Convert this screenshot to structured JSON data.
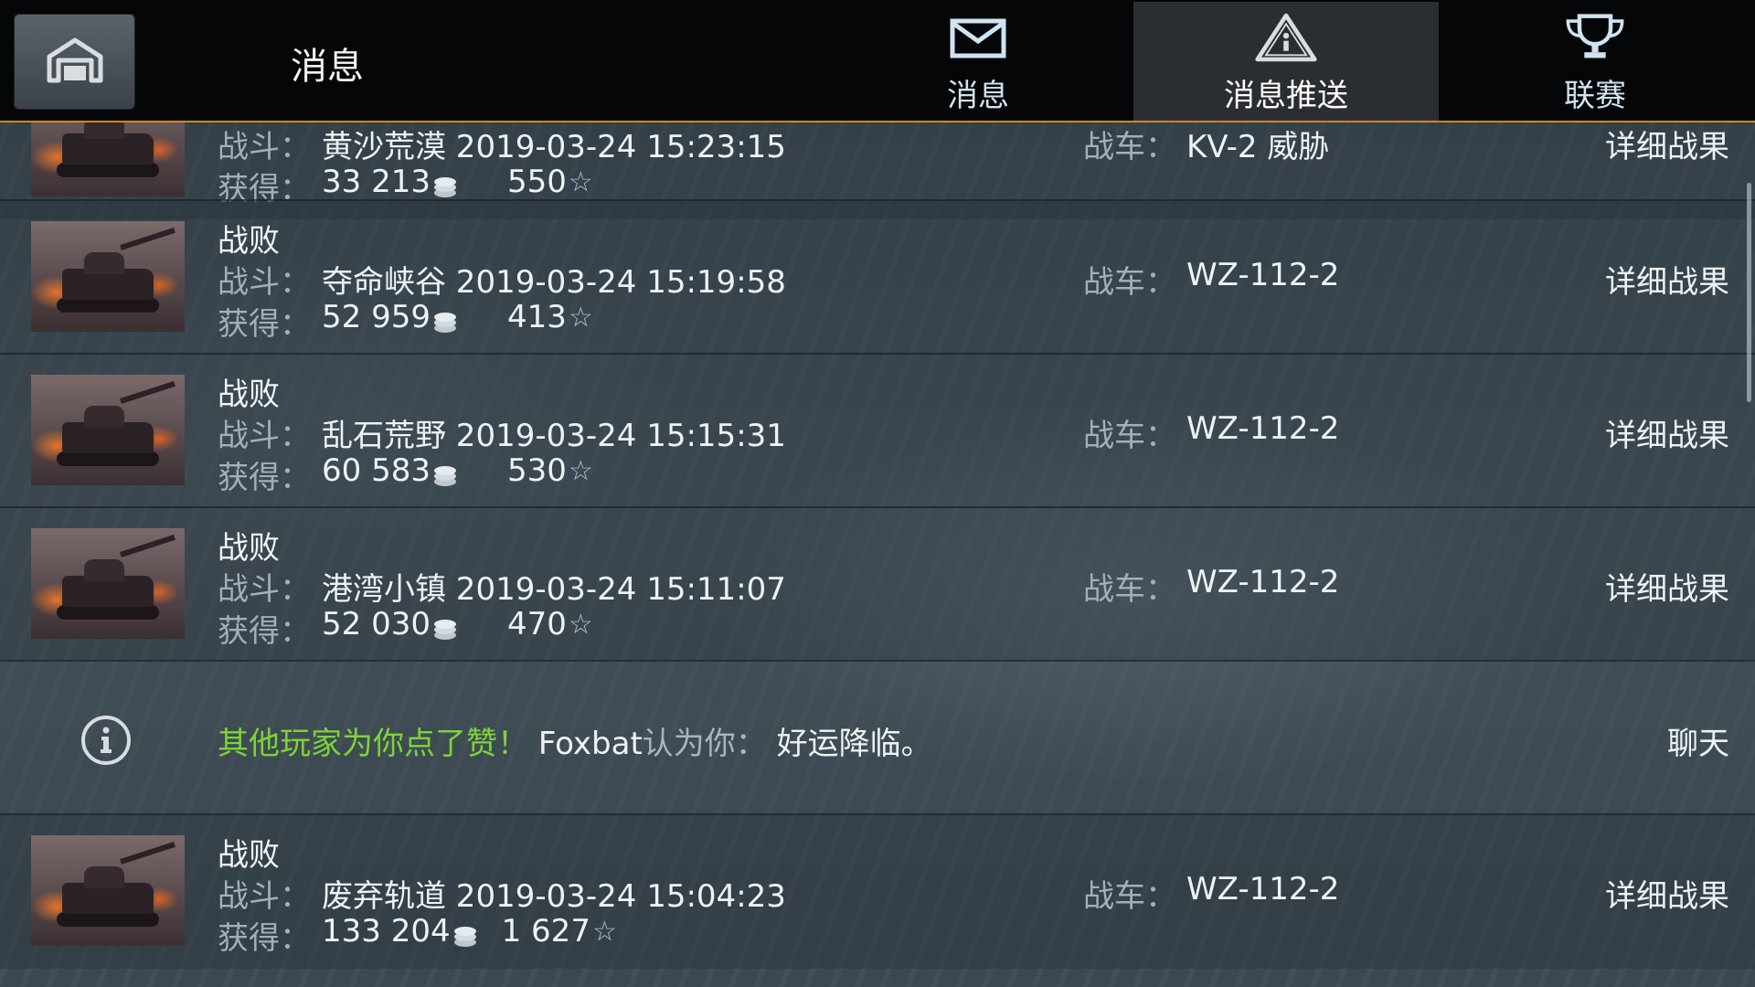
{
  "header": {
    "title": "消息",
    "home_icon": "hangar-home-icon",
    "tabs": [
      {
        "label": "消息",
        "icon": "envelope-icon",
        "active": false
      },
      {
        "label": "消息推送",
        "icon": "warning-triangle-icon",
        "active": true
      },
      {
        "label": "联赛",
        "icon": "trophy-icon",
        "active": false
      }
    ]
  },
  "colors": {
    "accent_line": "#c98a2c",
    "highlight_green": "#7dd338",
    "label_gray": "#9fb0bd"
  },
  "rows": [
    {
      "type": "battle",
      "result": "",
      "battle_label": "战斗：",
      "battle": "黄沙荒漠 2019-03-24 15:23:15",
      "earn_label": "获得：",
      "credits": "33 213",
      "xp": "550",
      "tank_label": "战车：",
      "tank": "KV-2 威胁",
      "details": "详细战果"
    },
    {
      "type": "battle",
      "result": "战败",
      "battle_label": "战斗：",
      "battle": "夺命峡谷 2019-03-24 15:19:58",
      "earn_label": "获得：",
      "credits": "52 959",
      "xp": "413",
      "tank_label": "战车：",
      "tank": "WZ-112-2",
      "details": "详细战果"
    },
    {
      "type": "battle",
      "result": "战败",
      "battle_label": "战斗：",
      "battle": "乱石荒野 2019-03-24 15:15:31",
      "earn_label": "获得：",
      "credits": "60 583",
      "xp": "530",
      "tank_label": "战车：",
      "tank": "WZ-112-2",
      "details": "详细战果"
    },
    {
      "type": "battle",
      "result": "战败",
      "battle_label": "战斗：",
      "battle": "港湾小镇 2019-03-24 15:11:07",
      "earn_label": "获得：",
      "credits": "52 030",
      "xp": "470",
      "tank_label": "战车：",
      "tank": "WZ-112-2",
      "details": "详细战果"
    },
    {
      "type": "info",
      "icon": "info-circle-icon",
      "green_text": "其他玩家为你点了赞！",
      "player": "Foxbat",
      "mid_text": "认为你：",
      "message": "好运降临。",
      "action": "聊天"
    },
    {
      "type": "battle",
      "result": "战败",
      "battle_label": "战斗：",
      "battle": "废弃轨道 2019-03-24 15:04:23",
      "earn_label": "获得：",
      "credits": "133 204",
      "xp": "1 627",
      "tank_label": "战车：",
      "tank": "WZ-112-2",
      "details": "详细战果"
    }
  ]
}
